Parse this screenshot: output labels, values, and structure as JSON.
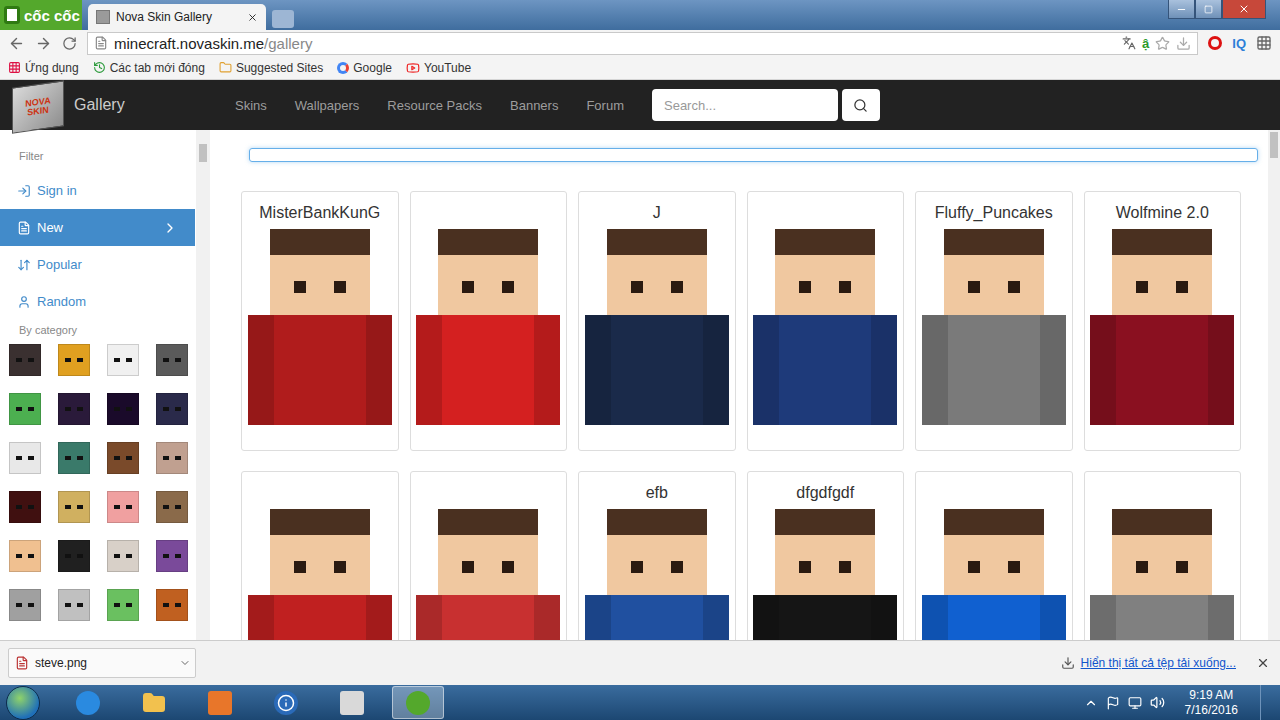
{
  "browser": {
    "logo": "cốc cốc",
    "tabs": [
      {
        "label": "Nova Skin Gallery",
        "selected": true
      }
    ],
    "url_host": "minecraft.novaskin.me",
    "url_path": "/gallery",
    "address_icons": [
      "ậ",
      "IQ"
    ]
  },
  "bookmarks": [
    {
      "label": "Ứng dụng",
      "kind": "apps"
    },
    {
      "label": "Các tab mới đóng",
      "kind": "history"
    },
    {
      "label": "Suggested Sites",
      "kind": "folder"
    },
    {
      "label": "Google",
      "kind": "google"
    },
    {
      "label": "YouTube",
      "kind": "youtube"
    }
  ],
  "site": {
    "logo_lines": [
      "NOVA",
      "SKIN"
    ],
    "brand": "Gallery",
    "nav": [
      "Skins",
      "Wallpapers",
      "Resource Packs",
      "Banners",
      "Forum"
    ],
    "search_placeholder": "Search..."
  },
  "sidebar": {
    "filter": "Filter",
    "items": [
      {
        "label": "Sign in",
        "kind": "signin",
        "selected": false
      },
      {
        "label": "New",
        "kind": "new",
        "selected": true
      },
      {
        "label": "Popular",
        "kind": "popular",
        "selected": false
      },
      {
        "label": "Random",
        "kind": "random",
        "selected": false
      }
    ],
    "category_heading": "By category",
    "categories": [
      {
        "color": "#3a3030"
      },
      {
        "color": "#e0a020"
      },
      {
        "color": "#f0f0f0"
      },
      {
        "color": "#5a5a5a"
      },
      {
        "color": "#4caf50"
      },
      {
        "color": "#2a1a3a"
      },
      {
        "color": "#1a0a2a"
      },
      {
        "color": "#2a2a4a"
      },
      {
        "color": "#e8e8e8"
      },
      {
        "color": "#3a7a6a"
      },
      {
        "color": "#7a4a2a"
      },
      {
        "color": "#c0a090"
      },
      {
        "color": "#401010"
      },
      {
        "color": "#d0b060"
      },
      {
        "color": "#f0a0a0"
      },
      {
        "color": "#8a6a4a"
      },
      {
        "color": "#f0c090"
      },
      {
        "color": "#202020"
      },
      {
        "color": "#d8d0c8"
      },
      {
        "color": "#7a4a9a"
      },
      {
        "color": "#a0a0a0"
      },
      {
        "color": "#c0c0c0"
      },
      {
        "color": "#6ac060"
      },
      {
        "color": "#c06020"
      }
    ]
  },
  "gallery": {
    "filter_value": "",
    "cards": [
      {
        "name": "MisterBankKunG",
        "color": "#b01c1c"
      },
      {
        "name": "",
        "color": "#d42020"
      },
      {
        "name": "J",
        "color": "#1a2a4a"
      },
      {
        "name": "",
        "color": "#1e3a7a"
      },
      {
        "name": "Fluffy_Puncakes",
        "color": "#7a7a7a"
      },
      {
        "name": "Wolfmine 2.0",
        "color": "#8a1020"
      },
      {
        "name": "",
        "color": "#c02020"
      },
      {
        "name": "",
        "color": "#c83030"
      },
      {
        "name": "efb",
        "color": "#2050a0"
      },
      {
        "name": "dfgdfgdf",
        "color": "#151515"
      },
      {
        "name": "",
        "color": "#1060d0"
      },
      {
        "name": "",
        "color": "#808080"
      }
    ]
  },
  "downloads": {
    "file": "steve.png",
    "show_all": "Hiển thị tất cả tệp tải xuống..."
  },
  "taskbar": {
    "time": "9:19 AM",
    "date": "7/16/2016"
  }
}
